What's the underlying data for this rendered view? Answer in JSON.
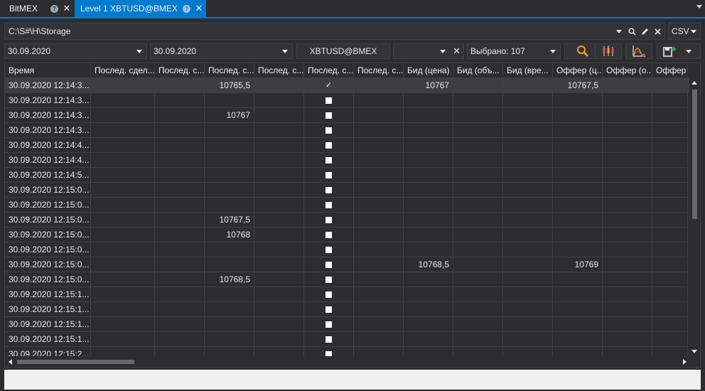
{
  "tabs": [
    {
      "label": "BitMEX",
      "help": "?",
      "close": "✕"
    },
    {
      "label": "Level 1 XBTUSD@BMEX",
      "help": "?",
      "close": "✕"
    }
  ],
  "storage": {
    "path": "C:\\S#\\H\\Storage",
    "format": "CSV"
  },
  "filters": {
    "from_date": "30.09.2020",
    "to_date": "30.09.2020",
    "security": "XBTUSD@BMEX",
    "type": "",
    "clear": "✕",
    "selected": "Выбрано: 107"
  },
  "accent": "#007acc",
  "search_color": "#f0a030",
  "icons": {
    "storage_search": "search-icon",
    "storage_edit": "pencil-icon",
    "storage_clear": "close-icon",
    "search": "search-icon",
    "candles": "candles-icon",
    "chart": "chart-icon",
    "export": "save-export-icon"
  },
  "table": {
    "columns": [
      "Время",
      "Послед. сдел...",
      "Послед. с...",
      "Послед. с...",
      "Послед. с...",
      "Послед. с...",
      "Послед. с...",
      "Бид (цена)",
      "Бид (объ...",
      "Бид (вре...",
      "Оффер (ц...",
      "Оффер (о...",
      "Оффер (..."
    ],
    "rows": [
      {
        "time": "30.09.2020 12:14:3...",
        "last_price": "10765,5",
        "checked": true,
        "bid": "10767",
        "ask": "10767,5"
      },
      {
        "time": "30.09.2020 12:14:3...",
        "last_price": "",
        "checked": false,
        "bid": "",
        "ask": ""
      },
      {
        "time": "30.09.2020 12:14:3...",
        "last_price": "10767",
        "checked": false,
        "bid": "",
        "ask": ""
      },
      {
        "time": "30.09.2020 12:14:3...",
        "last_price": "",
        "checked": false,
        "bid": "",
        "ask": ""
      },
      {
        "time": "30.09.2020 12:14:4...",
        "last_price": "",
        "checked": false,
        "bid": "",
        "ask": ""
      },
      {
        "time": "30.09.2020 12:14:4...",
        "last_price": "",
        "checked": false,
        "bid": "",
        "ask": ""
      },
      {
        "time": "30.09.2020 12:14:5...",
        "last_price": "",
        "checked": false,
        "bid": "",
        "ask": ""
      },
      {
        "time": "30.09.2020 12:15:0...",
        "last_price": "",
        "checked": false,
        "bid": "",
        "ask": ""
      },
      {
        "time": "30.09.2020 12:15:0...",
        "last_price": "",
        "checked": false,
        "bid": "",
        "ask": ""
      },
      {
        "time": "30.09.2020 12:15:0...",
        "last_price": "10767,5",
        "checked": false,
        "bid": "",
        "ask": ""
      },
      {
        "time": "30.09.2020 12:15:0...",
        "last_price": "10768",
        "checked": false,
        "bid": "",
        "ask": ""
      },
      {
        "time": "30.09.2020 12:15:0...",
        "last_price": "",
        "checked": false,
        "bid": "",
        "ask": ""
      },
      {
        "time": "30.09.2020 12:15:0...",
        "last_price": "",
        "checked": false,
        "bid": "10768,5",
        "ask": "10769"
      },
      {
        "time": "30.09.2020 12:15:0...",
        "last_price": "10768,5",
        "checked": false,
        "bid": "",
        "ask": ""
      },
      {
        "time": "30.09.2020 12:15:1...",
        "last_price": "",
        "checked": false,
        "bid": "",
        "ask": ""
      },
      {
        "time": "30.09.2020 12:15:1...",
        "last_price": "",
        "checked": false,
        "bid": "",
        "ask": ""
      },
      {
        "time": "30.09.2020 12:15:1...",
        "last_price": "",
        "checked": false,
        "bid": "",
        "ask": ""
      },
      {
        "time": "30.09.2020 12:15:1...",
        "last_price": "",
        "checked": false,
        "bid": "",
        "ask": ""
      },
      {
        "time": "30.09.2020 12:15:2...",
        "last_price": "",
        "checked": false,
        "bid": "",
        "ask": ""
      }
    ]
  }
}
